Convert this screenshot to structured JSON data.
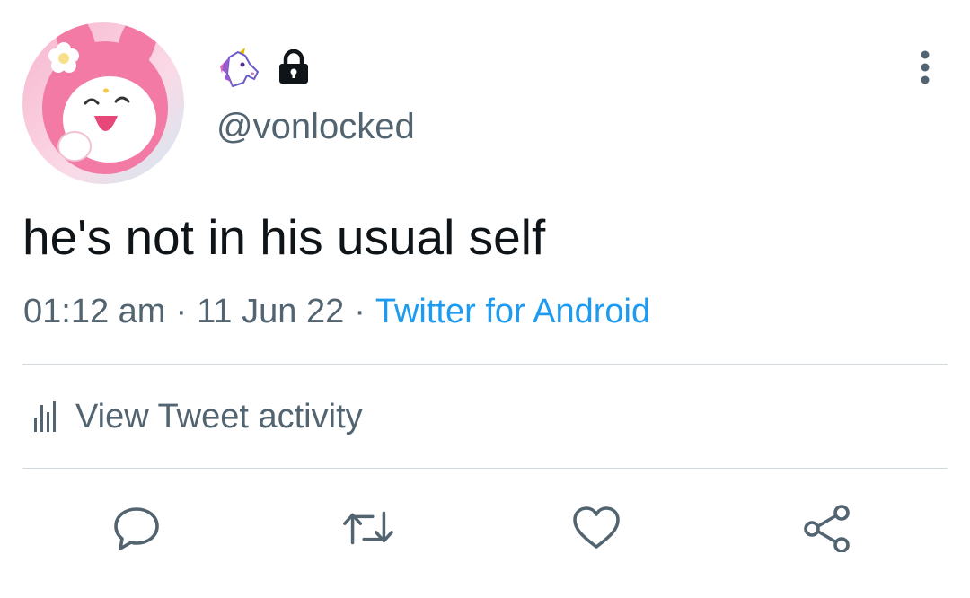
{
  "tweet": {
    "display_name_icons": [
      "unicorn-emoji",
      "lock-icon"
    ],
    "handle": "@vonlocked",
    "text": "he's not in his usual self",
    "time": "01:12 am",
    "separator": "·",
    "date": "11 Jun 22",
    "source": "Twitter for Android",
    "activity_label": "View Tweet activity"
  },
  "actions": [
    "reply-icon",
    "retweet-icon",
    "like-icon",
    "share-icon"
  ],
  "colors": {
    "text": "#0f1419",
    "secondary": "#536471",
    "link": "#1d9bf0",
    "divider": "#cfd9de"
  }
}
